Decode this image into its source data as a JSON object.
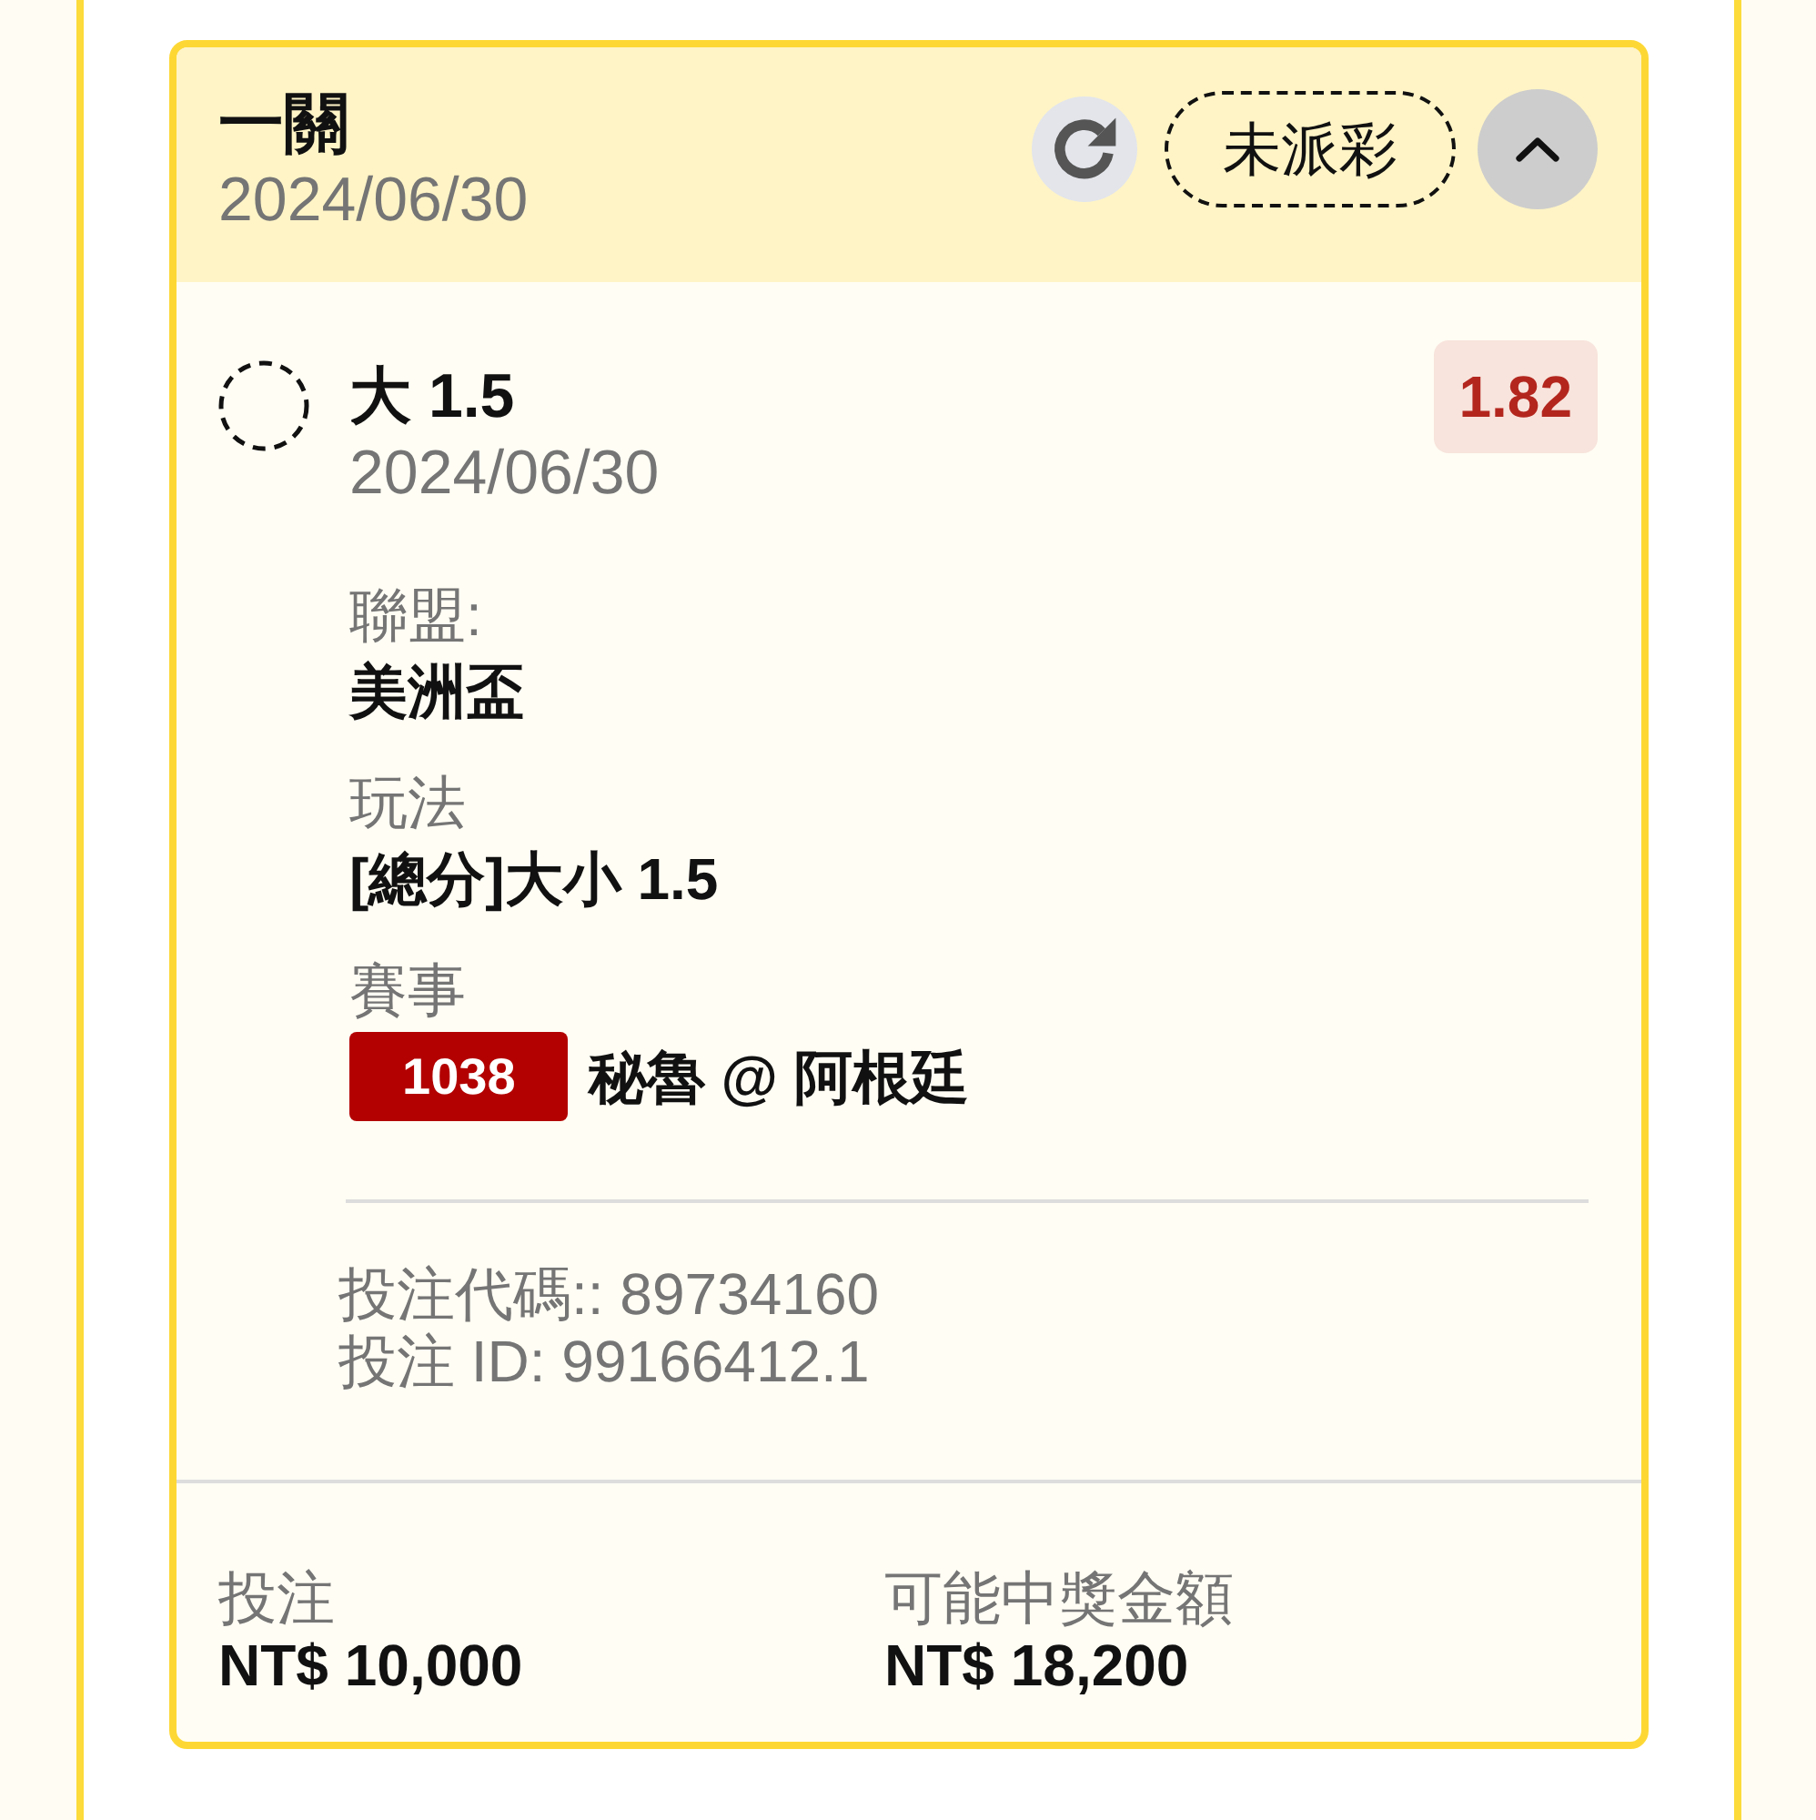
{
  "bet_card": {
    "header": {
      "title": "一關",
      "date": "2024/06/30",
      "status": "未派彩",
      "expanded": true
    },
    "selections": [
      {
        "name": "大 1.5",
        "date": "2024/06/30",
        "odds": "1.82",
        "details": [
          {
            "kind": "text",
            "label": "聯盟:",
            "value": "美洲盃"
          },
          {
            "kind": "text",
            "label": "玩法",
            "value": "[總分]大小 1.5"
          },
          {
            "kind": "match",
            "label": "賽事",
            "match_code": "1038",
            "value": "秘魯 @ 阿根廷"
          }
        ],
        "bet_code": "投注代碼:: 89734160",
        "bet_id": "投注 ID: 99166412.1"
      }
    ],
    "summary": [
      {
        "label": "投注",
        "value": "NT$ 10,000"
      },
      {
        "label": "可能中獎金額",
        "value": "NT$ 18,200"
      }
    ]
  }
}
